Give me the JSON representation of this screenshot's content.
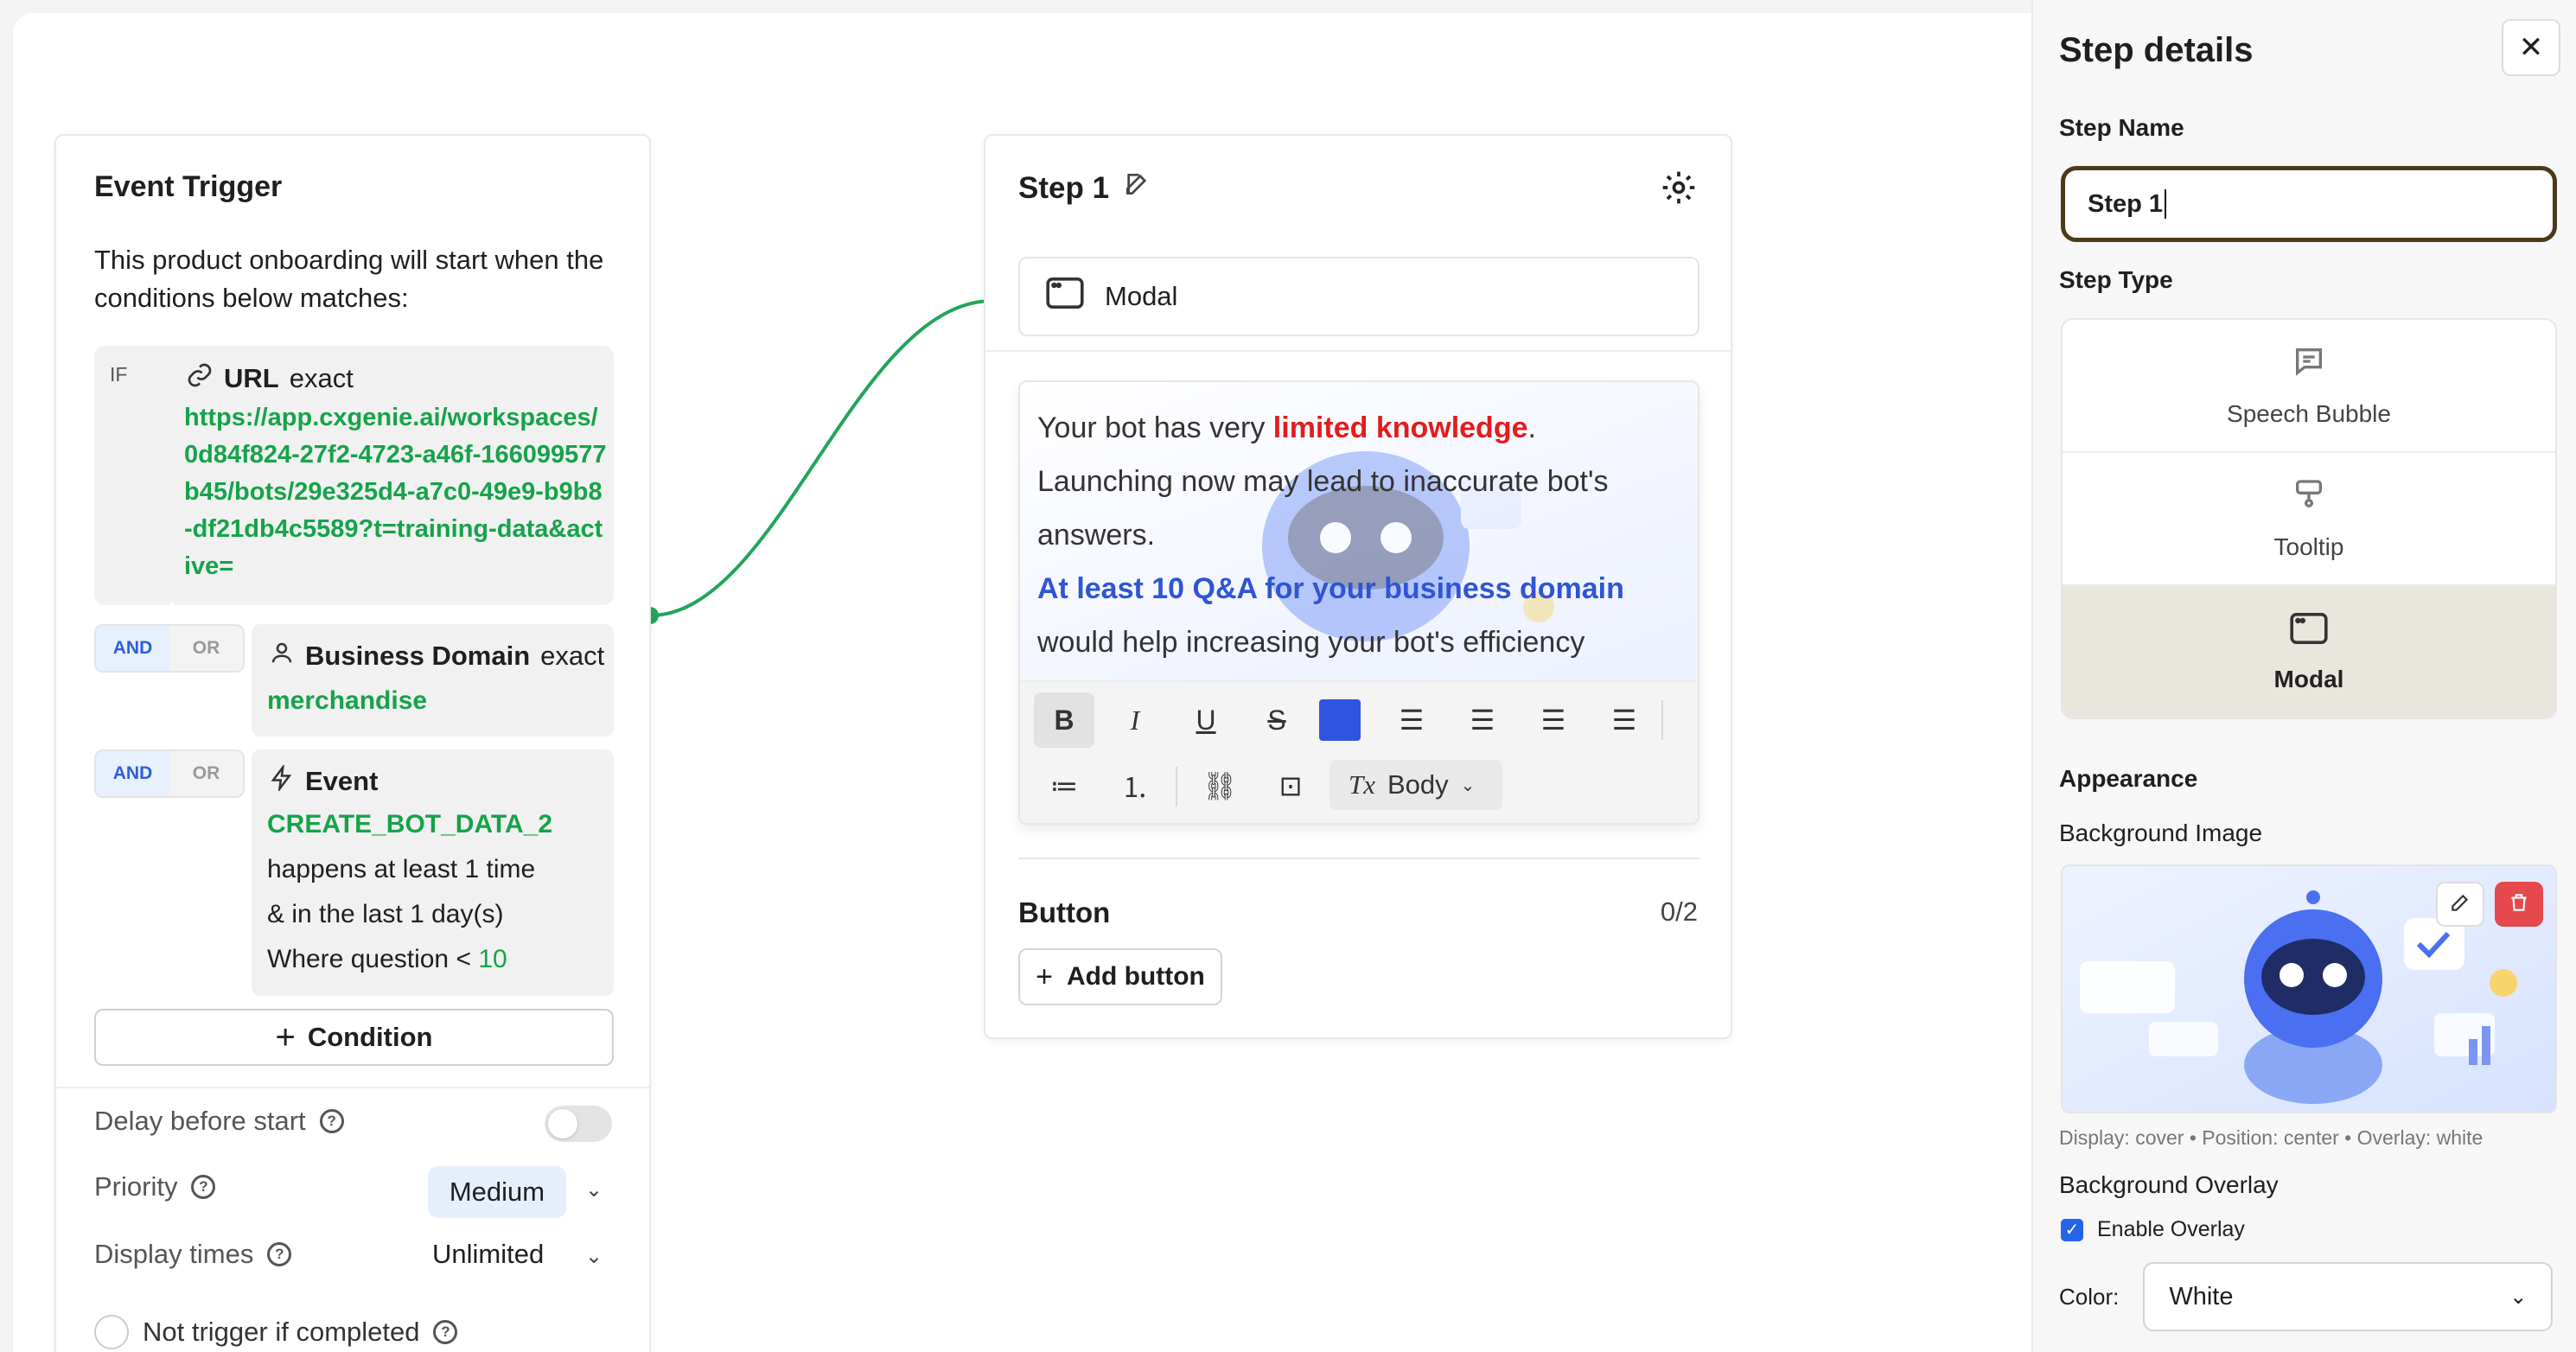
{
  "trigger": {
    "title": "Event Trigger",
    "description": "This product onboarding will start when the conditions below matches:",
    "if_label": "IF",
    "condition1": {
      "label": "URL",
      "op": "exact",
      "value": "https://app.cxgenie.ai/workspaces/0d84f824-27f2-4723-a46f-166099577b45/bots/29e325d4-a7c0-49e9-b9b8-df21db4c5589?t=training-data&active="
    },
    "condition2": {
      "and": "AND",
      "or": "OR",
      "label": "Business Domain",
      "op": "exact",
      "value": "merchandise"
    },
    "condition3": {
      "and": "AND",
      "or": "OR",
      "label": "Event",
      "value": "CREATE_BOT_DATA_2",
      "line1": "happens at least 1 time",
      "line2": "& in the last 1 day(s)",
      "line3_prefix": "Where question <",
      "line3_value": "10"
    },
    "add_condition": "Condition",
    "delay_label": "Delay before start",
    "priority_label": "Priority",
    "priority_value": "Medium",
    "display_label": "Display times",
    "display_value": "Unlimited",
    "not_trigger_label": "Not trigger if completed"
  },
  "step": {
    "title": "Step 1",
    "type": "Modal",
    "text": {
      "p1_a": "Your bot has very ",
      "p1_red": "limited knowledge",
      "p1_b": ".",
      "p2": "Launching now may lead to inaccurate bot's answers.",
      "p3_blue": "At least 10 Q&A for your business domain",
      "p4": "would help increasing your bot's efficiency"
    },
    "toolbar_style": "Body",
    "button_label": "Button",
    "button_count": "0/2",
    "add_button": "Add button"
  },
  "panel": {
    "title": "Step details",
    "step_name_label": "Step Name",
    "step_name_value": "Step 1",
    "step_type_label": "Step Type",
    "types": [
      "Speech Bubble",
      "Tooltip",
      "Modal"
    ],
    "selected_type": "Modal",
    "appearance_label": "Appearance",
    "bg_image_label": "Background Image",
    "bg_meta": "Display: cover • Position: center • Overlay: white",
    "bg_overlay_label": "Background Overlay",
    "enable_overlay": "Enable Overlay",
    "color_label": "Color:",
    "color_value": "White"
  },
  "colors": {
    "accent_green": "#16a34a",
    "text_red": "#e11d1d",
    "text_blue": "#2f55d4",
    "swatch": "#2f55e0",
    "input_border": "#4b3a1a"
  }
}
